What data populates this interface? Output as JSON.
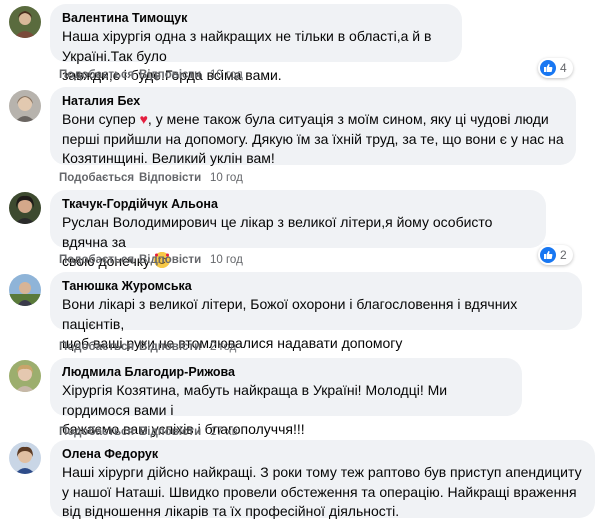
{
  "comments": [
    {
      "author": "Валентина Тимощук",
      "text": "Наша хірургія одна з найкращих не тільки в області,а й в Україні.Так було\nзавжди,є і буде.Горда всіма вами.",
      "like": "Подобається",
      "reply": "Відповісти",
      "time": "10 год",
      "reactions": "4",
      "reaction_icon": "like-icon"
    },
    {
      "author": "Наталия Бех",
      "text_before": "Вони супер ",
      "heart": "♥",
      "text_after": ", у мене також була ситуація з моїм сином, яку ці чудові люди\nперші прийшли на допомогу. Дякую їм за їхній труд, за те, що вони є у нас на\nКозятинщині. Великий уклін вам!",
      "like": "Подобається",
      "reply": "Відповісти",
      "time": "10 год"
    },
    {
      "author": "Ткачук-Гордійчук Альона",
      "text": "Руслан Володимирович це лікар з великої літери,я йому особисто вдячна за\nсвою донечку",
      "emoji": "smiling-face-with-hearts-emoji",
      "like": "Подобається",
      "reply": "Відповісти",
      "time": "10 год",
      "reactions": "2",
      "reaction_icon": "like-icon"
    },
    {
      "author": "Танюшка Журомська",
      "text": "Вони лікарі з великої літери, Божої охорони і благословення і вдячних пацієнтів,\nщоб ваші руки не втомлювалися надавати допомогу",
      "like": "Подобається",
      "reply": "Відповісти",
      "time": "2 год"
    },
    {
      "author": "Людмила Благодир-Рижова",
      "text": "Хірургія Козятина, мабуть найкраща в Україні! Молодці! Ми гордимося вами і\nбажаємо вам успіхів і благополуччя!!!",
      "like": "Подобається",
      "reply": "Відповісти",
      "time": "17 хв"
    },
    {
      "author": "Олена Федорук",
      "text": "Наші хірурги дійсно найкращі. З роки тому теж раптово був приступ апендициту\nу нашої Наташі. Швидко провели обстеження та операцію. Найкращі враження\nвід відношення лікарів та їх професійної діяльності."
    }
  ],
  "colors": {
    "bubble": "#f0f2f5",
    "meta_text": "#65676b",
    "like_blue": "#1877f2",
    "heart_red": "#e41e3f"
  }
}
